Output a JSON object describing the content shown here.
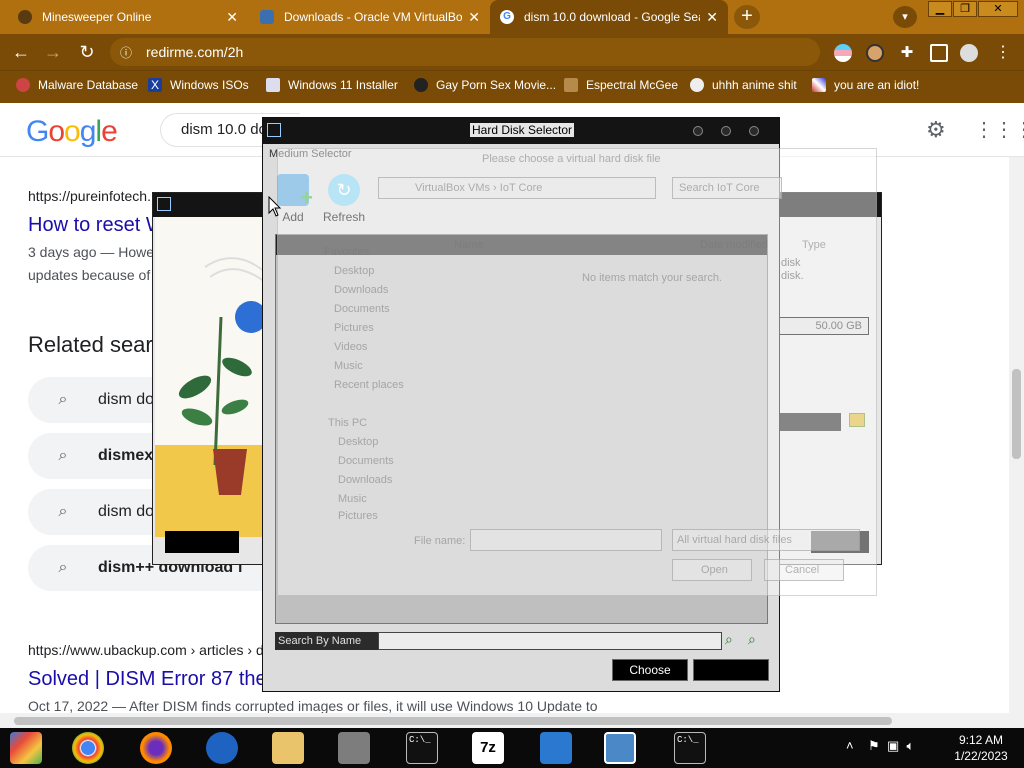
{
  "browser": {
    "tabs": [
      {
        "title": "Minesweeper Online",
        "active": false
      },
      {
        "title": "Downloads - Oracle VM VirtualBox",
        "active": false
      },
      {
        "title": "dism 10.0 download - Google Search",
        "active": true
      }
    ],
    "url": "redirme.com/2h",
    "bookmarks": [
      "Malware Database",
      "Windows ISOs",
      "Windows 11 Installer",
      "Gay Porn Sex Movie...",
      "Espectral McGee",
      "uhhh anime shit",
      "you are an idiot!"
    ],
    "theme_color": "#7a4b06"
  },
  "google": {
    "logo": "Google",
    "query": "dism 10.0 do",
    "result1": {
      "url": "https://pureinfotech.",
      "title": "How to reset W",
      "date": "3 days ago — Howe",
      "snippet": "updates because of"
    },
    "related_heading": "Related sear",
    "related": [
      {
        "text": "dism do",
        "bold": false
      },
      {
        "text": "dismex",
        "bold": true
      },
      {
        "text": "dism do",
        "bold": false
      },
      {
        "text": "dism++ download f",
        "bold": true
      }
    ],
    "result2": {
      "url": "https://www.ubackup.com › articles › d",
      "title": "Solved | DISM Error 87 the",
      "snippet": "Oct 17, 2022 — After DISM finds corrupted images or files, it will use Windows 10 Update to"
    }
  },
  "virtualbox_behind": {
    "size_value": "50.00 GB",
    "text_lines": [
      "disk",
      "disk."
    ]
  },
  "hard_disk_selector": {
    "title": "Hard Disk Selector",
    "section": "Medium Selector",
    "add_label": "Add",
    "refresh_label": "Refresh",
    "search_by": "Search By Name",
    "choose_label": "Choose"
  },
  "ghost_dialog": {
    "prompt": "Please choose a virtual hard disk file",
    "breadcrumb": "VirtualBox VMs › IoT Core",
    "search_placeholder": "Search IoT Core",
    "col_name": "Name",
    "col_date": "Date modified",
    "col_type": "Type",
    "empty": "No items match your search.",
    "sidebar": [
      "Favorites",
      "Desktop",
      "Downloads",
      "Documents",
      "Pictures",
      "Videos",
      "Music",
      "Recent places",
      "This PC",
      "Desktop",
      "Documents",
      "Downloads",
      "Music",
      "Pictures"
    ],
    "filename_label": "File name:",
    "filter": "All virtual hard disk files",
    "open_label": "Open",
    "cancel_label": "Cancel"
  },
  "taskbar": {
    "time": "9:12 AM",
    "date": "1/22/2023"
  }
}
